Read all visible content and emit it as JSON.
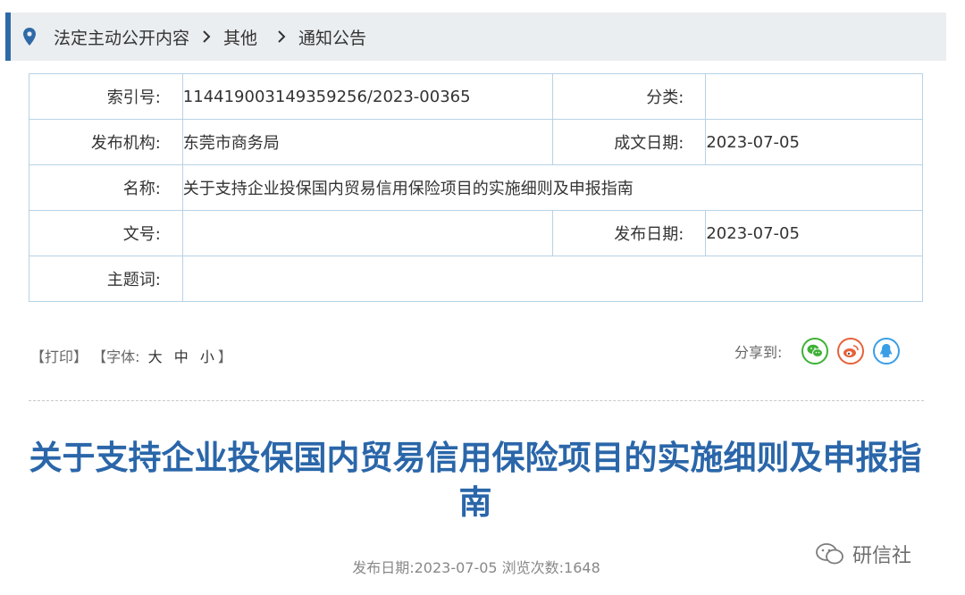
{
  "breadcrumb": {
    "icon": "location-pin-icon",
    "items": [
      "法定主动公开内容",
      "其他",
      "通知公告"
    ]
  },
  "meta": {
    "index_label": "索引号:",
    "index_value": "114419003149359256/2023-00365",
    "category_label": "分类:",
    "category_value": "",
    "issuer_label": "发布机构:",
    "issuer_value": "东莞市商务局",
    "written_date_label": "成文日期:",
    "written_date_value": "2023-07-05",
    "name_label": "名称:",
    "name_value": "关于支持企业投保国内贸易信用保险项目的实施细则及申报指南",
    "doc_no_label": "文号:",
    "doc_no_value": "",
    "publish_date_label": "发布日期:",
    "publish_date_value": "2023-07-05",
    "subject_label": "主题词:",
    "subject_value": ""
  },
  "tools": {
    "print": "【打印】",
    "font_prefix": "【字体:",
    "font_large": "大",
    "font_medium": "中",
    "font_small": "小",
    "font_suffix": "】"
  },
  "share": {
    "label": "分享到:",
    "icons": [
      "wechat-icon",
      "weibo-icon",
      "qq-icon"
    ],
    "colors": {
      "wechat": "#3eb135",
      "weibo": "#e6623a",
      "qq": "#3a9ee6"
    }
  },
  "article": {
    "title": "关于支持企业投保国内贸易信用保险项目的实施细则及申报指南",
    "info": "发布日期:2023-07-05  浏览次数:1648"
  },
  "watermark": {
    "text": "研信社"
  },
  "colors": {
    "accent": "#2f6aa8",
    "title": "#2a66a9",
    "table_border": "#b7d2e6",
    "breadcrumb_bg": "#ebeef1"
  }
}
